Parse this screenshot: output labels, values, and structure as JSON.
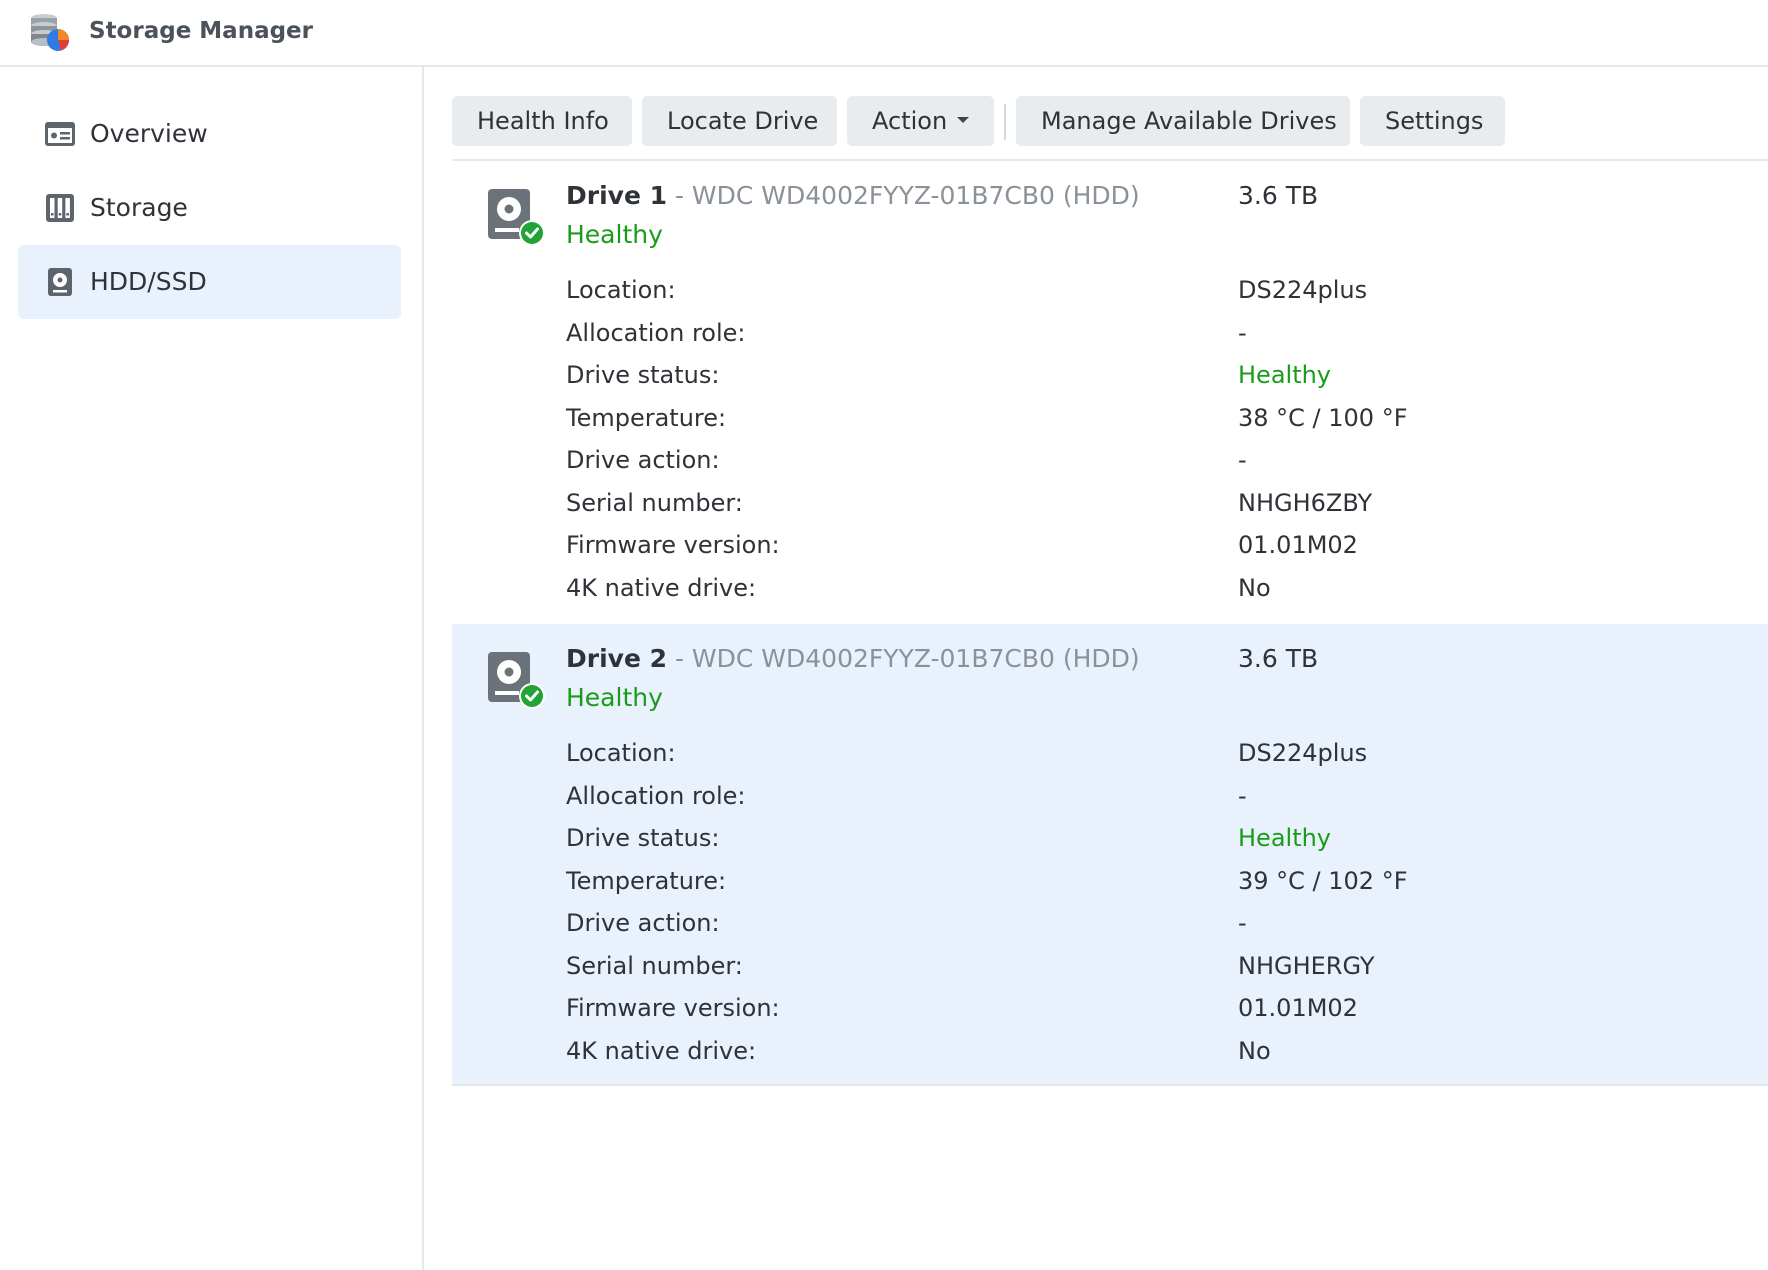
{
  "app": {
    "title": "Storage Manager"
  },
  "sidebar": {
    "items": [
      {
        "label": "Overview",
        "icon": "overview-icon",
        "active": false
      },
      {
        "label": "Storage",
        "icon": "storage-icon",
        "active": false
      },
      {
        "label": "HDD/SSD",
        "icon": "hdd-icon",
        "active": true
      }
    ]
  },
  "toolbar": {
    "health_info": "Health Info",
    "locate_drive": "Locate Drive",
    "action": "Action",
    "manage_drives": "Manage Available Drives",
    "settings": "Settings"
  },
  "colors": {
    "healthy": "#1a9c1a",
    "selected_bg": "#e9f1fc",
    "button_bg": "#e9ecef"
  },
  "labels": {
    "location": "Location:",
    "allocation_role": "Allocation role:",
    "drive_status": "Drive status:",
    "temperature": "Temperature:",
    "drive_action": "Drive action:",
    "serial_number": "Serial number:",
    "firmware_version": "Firmware version:",
    "native_4k": "4K native drive:"
  },
  "drives": [
    {
      "name": "Drive 1",
      "model": " - WDC WD4002FYYZ-01B7CB0 (HDD)",
      "size": "3.6 TB",
      "health": "Healthy",
      "location": "DS224plus",
      "allocation_role": "-",
      "drive_status": "Healthy",
      "temperature": "38 °C / 100 °F",
      "drive_action": "-",
      "serial_number": "NHGH6ZBY",
      "firmware_version": "01.01M02",
      "native_4k": "No"
    },
    {
      "name": "Drive 2",
      "model": " - WDC WD4002FYYZ-01B7CB0 (HDD)",
      "size": "3.6 TB",
      "health": "Healthy",
      "location": "DS224plus",
      "allocation_role": "-",
      "drive_status": "Healthy",
      "temperature": "39 °C / 102 °F",
      "drive_action": "-",
      "serial_number": "NHGHERGY",
      "firmware_version": "01.01M02",
      "native_4k": "No"
    }
  ]
}
